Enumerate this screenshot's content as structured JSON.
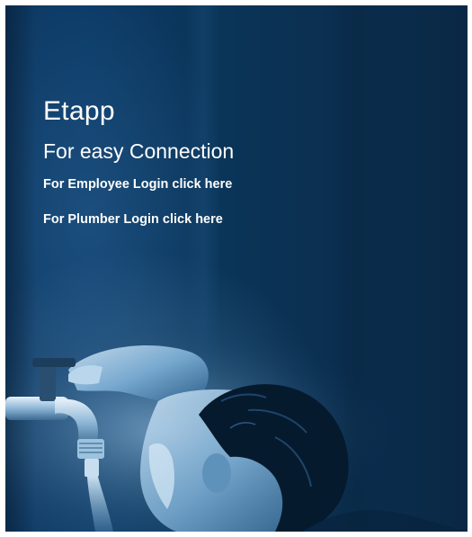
{
  "hero": {
    "app_name": "Etapp",
    "tagline": "For easy Connection",
    "employee_login_link": "For Employee Login click here",
    "plumber_login_link": "For Plumber Login click here"
  },
  "colors": {
    "background_dark": "#0a2f52",
    "background_mid": "#0e3a64",
    "text": "#ffffff"
  },
  "image": {
    "subject": "child-drinking-from-tap"
  }
}
